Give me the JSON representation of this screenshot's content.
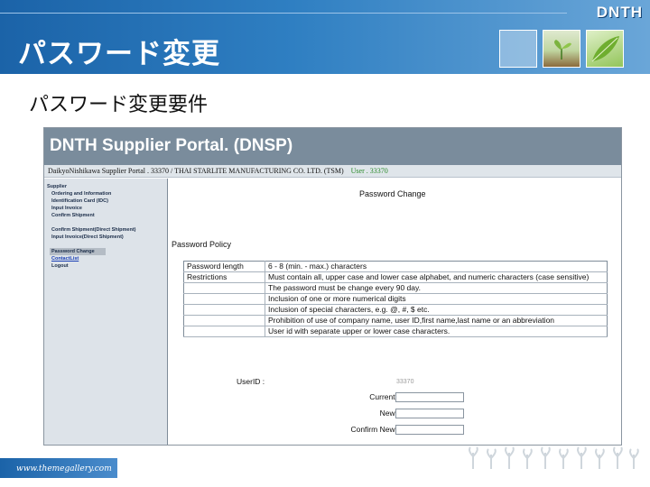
{
  "slide": {
    "title": "パスワード変更",
    "subtitle": "パスワード変更要件",
    "brand": "DNTH",
    "footer_url": "www.themegallery.com"
  },
  "portal": {
    "header_title": "DNTH Supplier Portal.  (DNSP)",
    "infobar_text": "DaikyoNishikawa Supplier Portal . 33370 / THAI STARLITE MANUFACTURING CO. LTD. (TSM)",
    "infobar_user": "User . 33370",
    "sidebar": {
      "section_label": "Supplier",
      "items": [
        "Ordering and Information",
        "Identification Card (IDC)",
        "Input Invoice",
        "Confirm Shipment"
      ],
      "items2": [
        "Confirm Shipment(Direct Shipment)",
        "Input Invoice(Direct Shipment)"
      ],
      "items3": [
        "Password Change",
        "ContactList",
        "Logout"
      ]
    },
    "content": {
      "title": "Password Change",
      "policy_title": "Password Policy",
      "policy_rows": [
        {
          "label": "Password length",
          "text": "6 - 8 (min. - max.) characters"
        },
        {
          "label": "Restrictions",
          "text": "Must contain all, upper case and lower case alphabet, and numeric characters (case sensitive)"
        },
        {
          "label": "",
          "text": "The password must be change every 90 day."
        },
        {
          "label": "",
          "text": "Inclusion of one or more numerical digits"
        },
        {
          "label": "",
          "text": "Inclusion of special characters, e.g. @, #, $ etc."
        },
        {
          "label": "",
          "text": "Prohibition of use of company name, user ID,first name,last name or an abbreviation"
        },
        {
          "label": "",
          "text": "User id with separate upper or lower case characters."
        }
      ],
      "form": {
        "userid_label": "UserID :",
        "userid_value": "33370",
        "current_label": "Current Password :",
        "new_label": "New Password :",
        "confirm_label": "Confirm New Password :",
        "current_value": "",
        "new_value": "",
        "confirm_value": ""
      }
    }
  },
  "icons": {
    "footer_decoration": "seedling-pattern-icon"
  },
  "colors": {
    "header_blue": "#1b63a8",
    "portal_header_gray": "#7a8c9c",
    "user_green": "#2a8a2a"
  }
}
